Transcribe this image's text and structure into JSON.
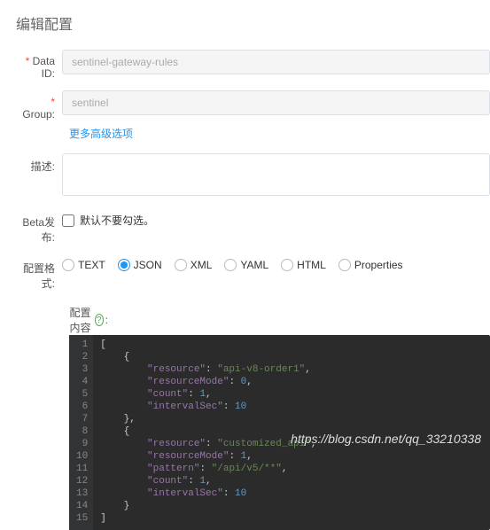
{
  "title": "编辑配置",
  "labels": {
    "dataId": "Data ID:",
    "group": "Group:",
    "desc": "描述:",
    "beta": "Beta发布:",
    "format": "配置格式:",
    "content": "配置内容"
  },
  "fields": {
    "dataId": "sentinel-gateway-rules",
    "group": "sentinel",
    "desc": "",
    "betaCheckboxLabel": "默认不要勾选。"
  },
  "advancedLink": "更多高级选项",
  "formats": [
    "TEXT",
    "JSON",
    "XML",
    "YAML",
    "HTML",
    "Properties"
  ],
  "selectedFormat": "JSON",
  "helpGlyph": "?",
  "code": {
    "lines": [
      {
        "n": 1,
        "tokens": [
          {
            "t": "[",
            "c": "punc"
          },
          {
            "t": "",
            "c": "punc"
          }
        ]
      },
      {
        "n": 2,
        "tokens": [
          {
            "t": "    {",
            "c": "punc"
          }
        ]
      },
      {
        "n": 3,
        "tokens": [
          {
            "t": "        ",
            "c": "punc"
          },
          {
            "t": "\"resource\"",
            "c": "key"
          },
          {
            "t": ": ",
            "c": "punc"
          },
          {
            "t": "\"api-v8-order1\"",
            "c": "str"
          },
          {
            "t": ",",
            "c": "punc"
          }
        ]
      },
      {
        "n": 4,
        "tokens": [
          {
            "t": "        ",
            "c": "punc"
          },
          {
            "t": "\"resourceMode\"",
            "c": "key"
          },
          {
            "t": ": ",
            "c": "punc"
          },
          {
            "t": "0",
            "c": "num"
          },
          {
            "t": ",",
            "c": "punc"
          }
        ]
      },
      {
        "n": 5,
        "tokens": [
          {
            "t": "        ",
            "c": "punc"
          },
          {
            "t": "\"count\"",
            "c": "key"
          },
          {
            "t": ": ",
            "c": "punc"
          },
          {
            "t": "1",
            "c": "num"
          },
          {
            "t": ",",
            "c": "punc"
          }
        ]
      },
      {
        "n": 6,
        "tokens": [
          {
            "t": "        ",
            "c": "punc"
          },
          {
            "t": "\"intervalSec\"",
            "c": "key"
          },
          {
            "t": ": ",
            "c": "punc"
          },
          {
            "t": "10",
            "c": "num"
          }
        ]
      },
      {
        "n": 7,
        "tokens": [
          {
            "t": "    },",
            "c": "punc"
          }
        ]
      },
      {
        "n": 8,
        "tokens": [
          {
            "t": "    {",
            "c": "punc"
          }
        ]
      },
      {
        "n": 9,
        "tokens": [
          {
            "t": "        ",
            "c": "punc"
          },
          {
            "t": "\"resource\"",
            "c": "key"
          },
          {
            "t": ": ",
            "c": "punc"
          },
          {
            "t": "\"customized_api\"",
            "c": "str"
          },
          {
            "t": ",",
            "c": "punc"
          }
        ]
      },
      {
        "n": 10,
        "tokens": [
          {
            "t": "        ",
            "c": "punc"
          },
          {
            "t": "\"resourceMode\"",
            "c": "key"
          },
          {
            "t": ": ",
            "c": "punc"
          },
          {
            "t": "1",
            "c": "num"
          },
          {
            "t": ",",
            "c": "punc"
          }
        ]
      },
      {
        "n": 11,
        "tokens": [
          {
            "t": "        ",
            "c": "punc"
          },
          {
            "t": "\"pattern\"",
            "c": "key"
          },
          {
            "t": ": ",
            "c": "punc"
          },
          {
            "t": "\"/api/v5/**\"",
            "c": "str"
          },
          {
            "t": ",",
            "c": "punc"
          }
        ]
      },
      {
        "n": 12,
        "tokens": [
          {
            "t": "        ",
            "c": "punc"
          },
          {
            "t": "\"count\"",
            "c": "key"
          },
          {
            "t": ": ",
            "c": "punc"
          },
          {
            "t": "1",
            "c": "num"
          },
          {
            "t": ",",
            "c": "punc"
          }
        ]
      },
      {
        "n": 13,
        "tokens": [
          {
            "t": "        ",
            "c": "punc"
          },
          {
            "t": "\"intervalSec\"",
            "c": "key"
          },
          {
            "t": ": ",
            "c": "punc"
          },
          {
            "t": "10",
            "c": "num"
          }
        ]
      },
      {
        "n": 14,
        "tokens": [
          {
            "t": "    }",
            "c": "punc"
          }
        ]
      },
      {
        "n": 15,
        "tokens": [
          {
            "t": "]",
            "c": "punc"
          }
        ]
      }
    ]
  },
  "watermark": "https://blog.csdn.net/qq_33210338"
}
